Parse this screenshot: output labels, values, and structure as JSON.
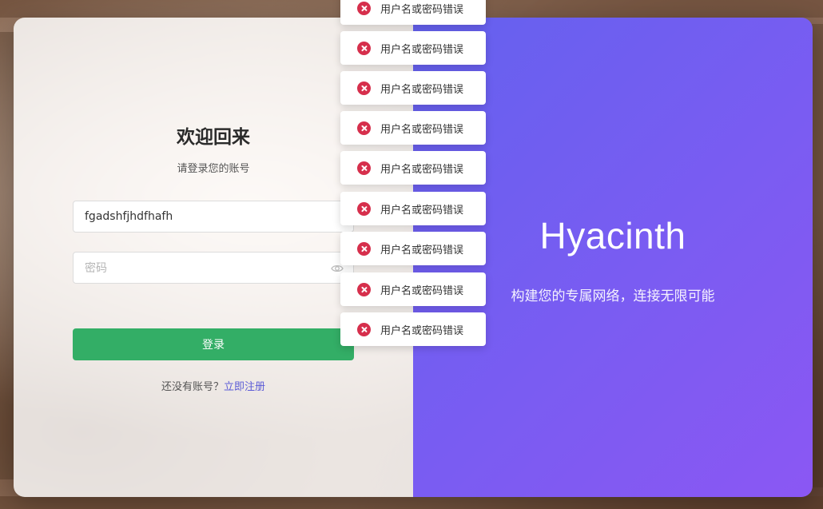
{
  "login": {
    "title": "欢迎回来",
    "subtitle": "请登录您的账号",
    "username_value": "fgadshfjhdfhafh",
    "password_placeholder": "密码",
    "login_button": "登录",
    "no_account_text": "还没有账号？",
    "register_link": "立即注册"
  },
  "brand": {
    "name": "Hyacinth",
    "tagline": "构建您的专属网络，连接无限可能"
  },
  "toasts": [
    {
      "text": "用户名或密码错误"
    },
    {
      "text": "用户名或密码错误"
    },
    {
      "text": "用户名或密码错误"
    },
    {
      "text": "用户名或密码错误"
    },
    {
      "text": "用户名或密码错误"
    },
    {
      "text": "用户名或密码错误"
    },
    {
      "text": "用户名或密码错误"
    },
    {
      "text": "用户名或密码错误"
    },
    {
      "text": "用户名或密码错误"
    }
  ],
  "icons": {
    "password_toggle": "eye-icon",
    "toast": "error-circle-icon"
  },
  "colors": {
    "primary_button": "#33ae66",
    "gradient_start": "#6461ee",
    "gradient_end": "#8b57f3",
    "error": "#d62f4c",
    "link": "#5b5bd6"
  }
}
